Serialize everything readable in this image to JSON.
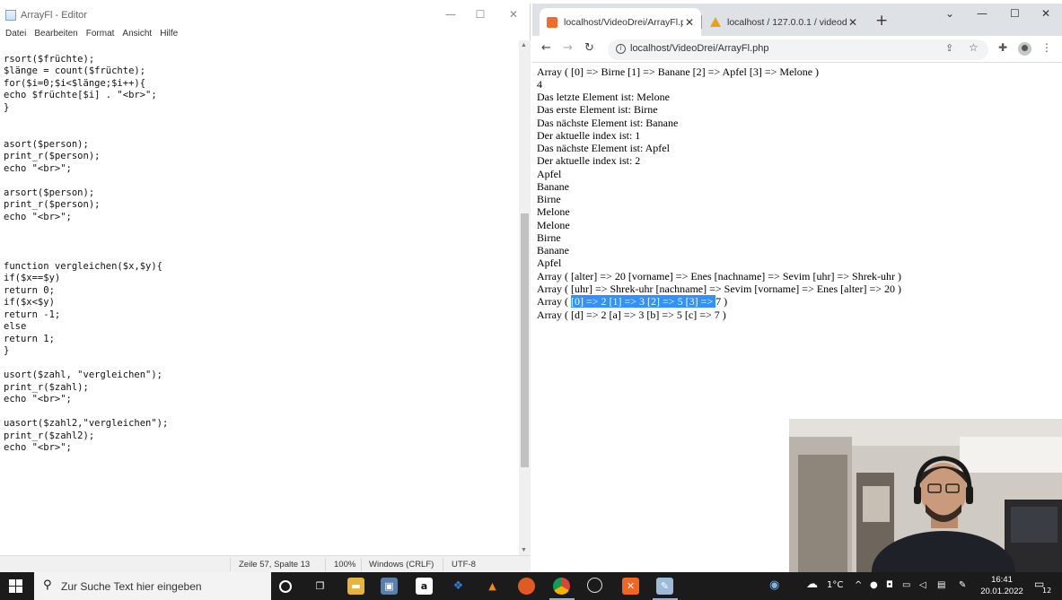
{
  "notepad": {
    "title": "ArrayFl - Editor",
    "window_controls": {
      "minimize": "—",
      "maximize": "☐",
      "close": "✕"
    },
    "menu": [
      "Datei",
      "Bearbeiten",
      "Format",
      "Ansicht",
      "Hilfe"
    ],
    "code_lines": [
      "",
      "rsort($früchte);",
      "$länge = count($früchte);",
      "for($i=0;$i<$länge;$i++){",
      "echo $früchte[$i] . \"<br>\";",
      "}",
      "",
      "",
      "asort($person);",
      "print_r($person);",
      "echo \"<br>\";",
      "",
      "arsort($person);",
      "print_r($person);",
      "echo \"<br>\";",
      "",
      "",
      "",
      "function vergleichen($x,$y){",
      "if($x==$y)",
      "return 0;",
      "if($x<$y)",
      "return -1;",
      "else",
      "return 1;",
      "}",
      "",
      "usort($zahl, \"vergleichen\");",
      "print_r($zahl);",
      "echo \"<br>\";",
      "",
      "uasort($zahl2,\"vergleichen\");",
      "print_r($zahl2);",
      "echo \"<br>\";"
    ],
    "status": {
      "position": "Zeile 57, Spalte 13",
      "zoom": "100%",
      "line_ending": "Windows (CRLF)",
      "encoding": "UTF-8"
    }
  },
  "browser": {
    "tabs": [
      {
        "label": "localhost/VideoDrei/ArrayFl.php",
        "close": "✕"
      },
      {
        "label": "localhost / 127.0.0.1 / videodrei /",
        "close": "✕"
      }
    ],
    "new_tab": "+",
    "window_controls": {
      "tab_search": "⌄",
      "minimize": "—",
      "maximize": "☐",
      "close": "✕"
    },
    "nav": {
      "back": "←",
      "forward": "→",
      "reload": "↻"
    },
    "url": "localhost/VideoDrei/ArrayFl.php",
    "output_lines": [
      "Array ( [0] => Birne [1] => Banane [2] => Apfel [3] => Melone )",
      "4",
      "Das letzte Element ist: Melone",
      "Das erste Element ist: Birne",
      "Das nächste Element ist: Banane",
      "Der aktuelle index ist: 1",
      "Das nächste Element ist: Apfel",
      "Der aktuelle index ist: 2",
      "Apfel",
      "Banane",
      "Birne",
      "Melone",
      "Melone",
      "Birne",
      "Banane",
      "Apfel",
      "Array ( [alter] => 20 [vorname] => Enes [nachname] => Sevim [uhr] => Shrek-uhr )",
      "Array ( [uhr] => Shrek-uhr [nachname] => Sevim [vorname] => Enes [alter] => 20 )"
    ],
    "selected_line": {
      "prefix": "Array ( ",
      "selected": "[0] => 2 [1] => 3 [2] => 5 [3] => ",
      "suffix": "7 )"
    },
    "last_line": "Array ( [d] => 2 [a] => 3 [b] => 5 [c] => 7 )"
  },
  "taskbar": {
    "search_placeholder": "Zur Suche Text hier eingeben",
    "weather": "1°C",
    "time": "16:41",
    "date": "20.01.2022",
    "notifications": "12"
  }
}
